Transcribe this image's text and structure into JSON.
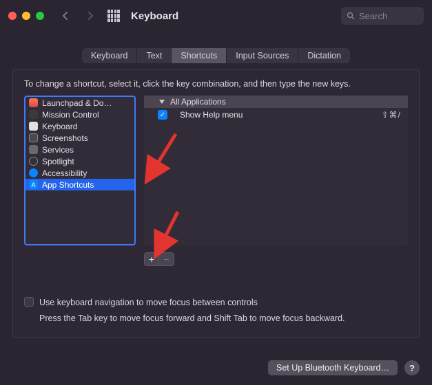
{
  "window": {
    "title": "Keyboard"
  },
  "search": {
    "placeholder": "Search"
  },
  "tabs": {
    "keyboard": "Keyboard",
    "text": "Text",
    "shortcuts": "Shortcuts",
    "input_sources": "Input Sources",
    "dictation": "Dictation"
  },
  "instruction": "To change a shortcut, select it, click the key combination, and then type the new keys.",
  "categories": [
    {
      "label": "Launchpad & Do…"
    },
    {
      "label": "Mission Control"
    },
    {
      "label": "Keyboard"
    },
    {
      "label": "Screenshots"
    },
    {
      "label": "Services"
    },
    {
      "label": "Spotlight"
    },
    {
      "label": "Accessibility"
    },
    {
      "label": "App Shortcuts"
    }
  ],
  "detail": {
    "group": "All Applications",
    "rows": [
      {
        "label": "Show Help menu",
        "shortcut": "⇧⌘/"
      }
    ]
  },
  "buttons": {
    "add": "+",
    "remove": "−"
  },
  "kbnav": {
    "label": "Use keyboard navigation to move focus between controls",
    "hint": "Press the Tab key to move focus forward and Shift Tab to move focus backward."
  },
  "footer": {
    "bluetooth": "Set Up Bluetooth Keyboard…",
    "help": "?"
  }
}
